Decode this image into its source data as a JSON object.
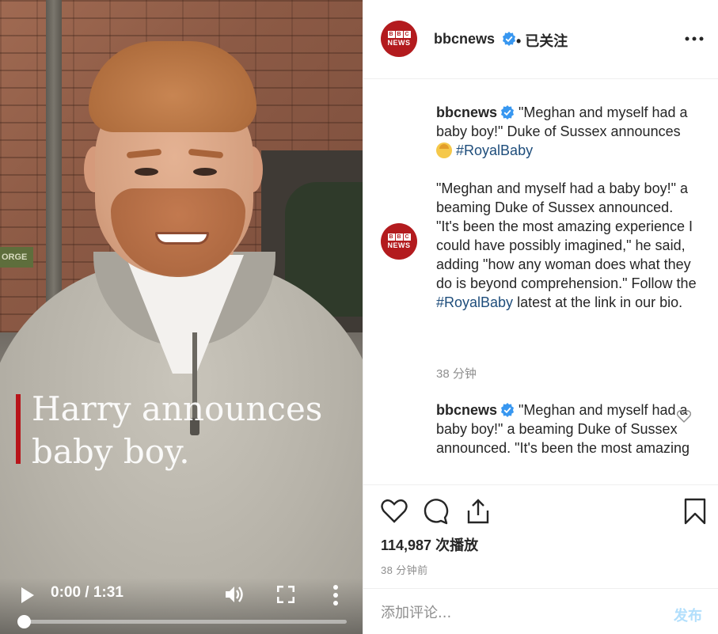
{
  "video": {
    "caption_line": "Harry announces\nbaby boy.",
    "sign_text": "ORGE",
    "time_display": "0:00 / 1:31",
    "progress_fraction": 0.0,
    "icons": [
      "play-icon",
      "volume-icon",
      "fullscreen-icon",
      "more-vertical-icon"
    ]
  },
  "header": {
    "avatar_bbc": [
      "B",
      "B",
      "C"
    ],
    "avatar_news": "NEWS",
    "username": "bbcnews",
    "follow_status": "• 已关注",
    "icons": [
      "verified-icon",
      "more-horizontal-icon"
    ]
  },
  "caption": {
    "username": "bbcnews",
    "text_before": " \"Meghan and myself had a baby boy!\" Duke of Sussex announces ",
    "hashtag": "#RoyalBaby",
    "body_1": "\"Meghan and myself had a baby boy!\" a beaming Duke of Sussex announced. \"It's been the most amazing experience I could have possibly imagined,\" he said, adding \"how any woman does what they do is beyond comprehension.\" Follow the ",
    "body_hashtag": "#RoyalBaby",
    "body_2": " latest at the link in our bio.",
    "time": "38 分钟"
  },
  "comment": {
    "username": "bbcnews",
    "text": " \"Meghan and myself had a baby boy!\" a beaming Duke of Sussex announced. \"It's been the most amazing"
  },
  "actions": {
    "icons": [
      "heart-icon",
      "comment-icon",
      "share-icon",
      "bookmark-icon"
    ],
    "views_count": "114,987",
    "views_label": "次播放",
    "time_ago": "38 分钟前"
  },
  "add_comment": {
    "placeholder": "添加评论...",
    "post_label": "发布"
  },
  "colors": {
    "bbc_red": "#b31b1e",
    "link_blue": "#1e4d7b",
    "verified_blue": "#3897f0",
    "post_disabled": "#b2dffc",
    "muted": "#8e8e8e"
  }
}
